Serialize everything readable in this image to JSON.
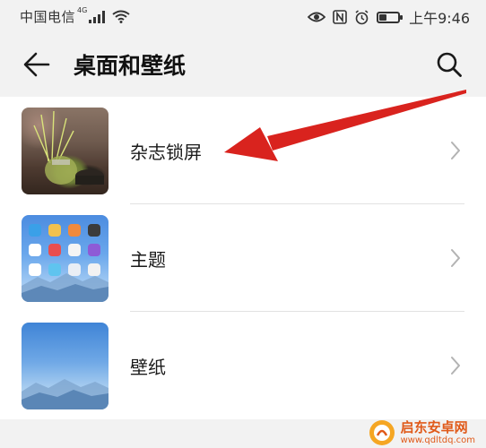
{
  "status_bar": {
    "carrier": "中国电信",
    "network": "4G",
    "time": "上午9:46",
    "battery_level": 0.35
  },
  "header": {
    "title": "桌面和壁纸",
    "back_icon": "arrow-left-icon",
    "search_icon": "search-icon"
  },
  "items": [
    {
      "label": "杂志锁屏",
      "thumbnail": "magazine-lockscreen-photo"
    },
    {
      "label": "主题",
      "thumbnail": "theme-home-screen-preview"
    },
    {
      "label": "壁纸",
      "thumbnail": "wallpaper-preview"
    }
  ],
  "annotation": {
    "color": "#d9231e",
    "points_to": "杂志锁屏"
  },
  "watermark": {
    "text": "启东安卓网",
    "url": "www.qdltdq.com"
  },
  "colors": {
    "background": "#f2f2f2",
    "card": "#ffffff",
    "divider": "#e2e2e2",
    "chevron": "#b3b3b3",
    "watermark": "#e05a1a"
  }
}
